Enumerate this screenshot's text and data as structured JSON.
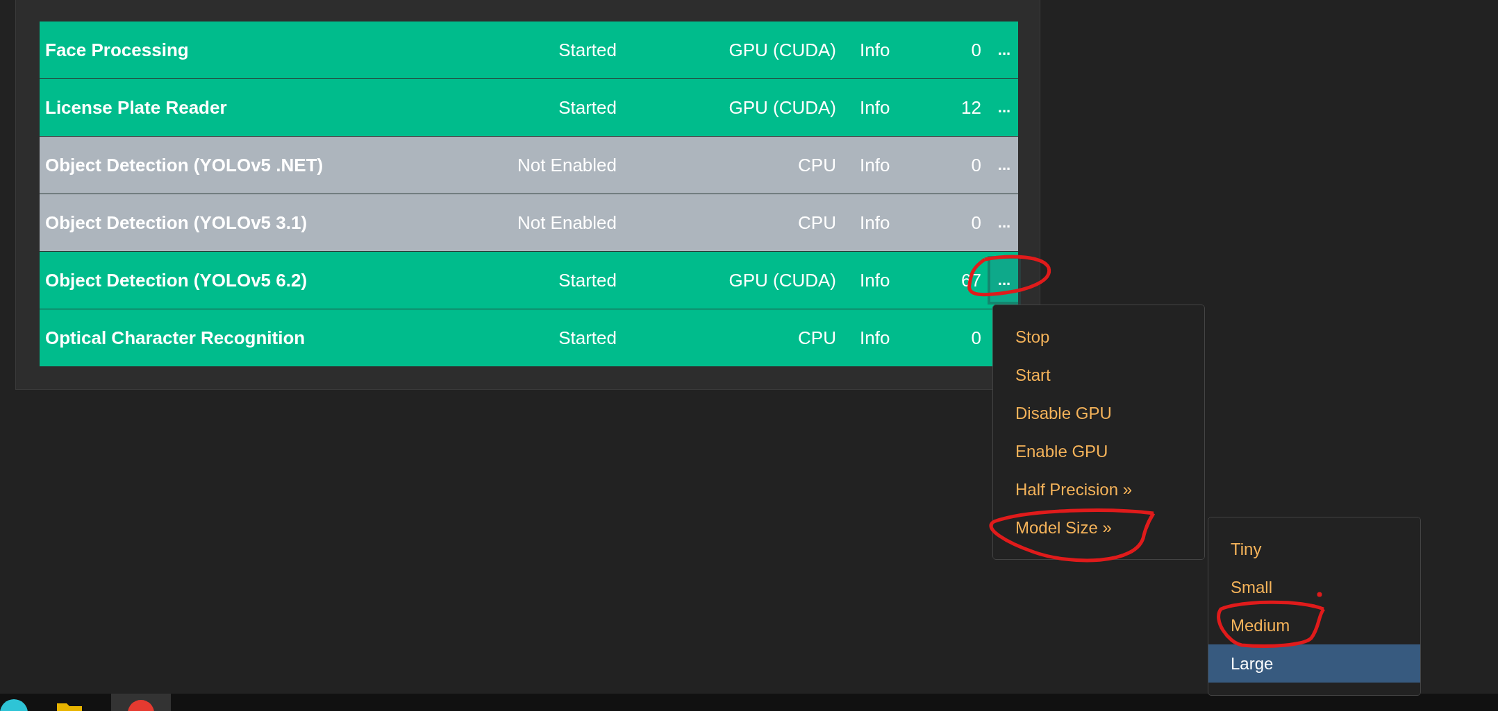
{
  "modules": [
    {
      "name": "Face Processing",
      "status": "Started",
      "processor": "GPU (CUDA)",
      "info": "Info",
      "count": "0",
      "more": "...",
      "active": true,
      "menu_open": false
    },
    {
      "name": "License Plate Reader",
      "status": "Started",
      "processor": "GPU (CUDA)",
      "info": "Info",
      "count": "12",
      "more": "...",
      "active": true,
      "menu_open": false
    },
    {
      "name": "Object Detection (YOLOv5 .NET)",
      "status": "Not Enabled",
      "processor": "CPU",
      "info": "Info",
      "count": "0",
      "more": "...",
      "active": false,
      "menu_open": false
    },
    {
      "name": "Object Detection (YOLOv5 3.1)",
      "status": "Not Enabled",
      "processor": "CPU",
      "info": "Info",
      "count": "0",
      "more": "...",
      "active": false,
      "menu_open": false
    },
    {
      "name": "Object Detection (YOLOv5 6.2)",
      "status": "Started",
      "processor": "GPU (CUDA)",
      "info": "Info",
      "count": "67",
      "more": "...",
      "active": true,
      "menu_open": true
    },
    {
      "name": "Optical Character Recognition",
      "status": "Started",
      "processor": "CPU",
      "info": "Info",
      "count": "0",
      "active": true
    }
  ],
  "context_menu": [
    {
      "label": "Stop",
      "selected": false
    },
    {
      "label": "Start",
      "selected": false
    },
    {
      "label": "Disable GPU",
      "selected": false
    },
    {
      "label": "Enable GPU",
      "selected": false
    },
    {
      "label": "Half Precision »",
      "selected": false
    },
    {
      "label": "Model Size »",
      "selected": false
    }
  ],
  "submenu": [
    {
      "label": "Tiny",
      "selected": false
    },
    {
      "label": "Small",
      "selected": false
    },
    {
      "label": "Medium",
      "selected": false
    },
    {
      "label": "Large",
      "selected": true
    }
  ]
}
